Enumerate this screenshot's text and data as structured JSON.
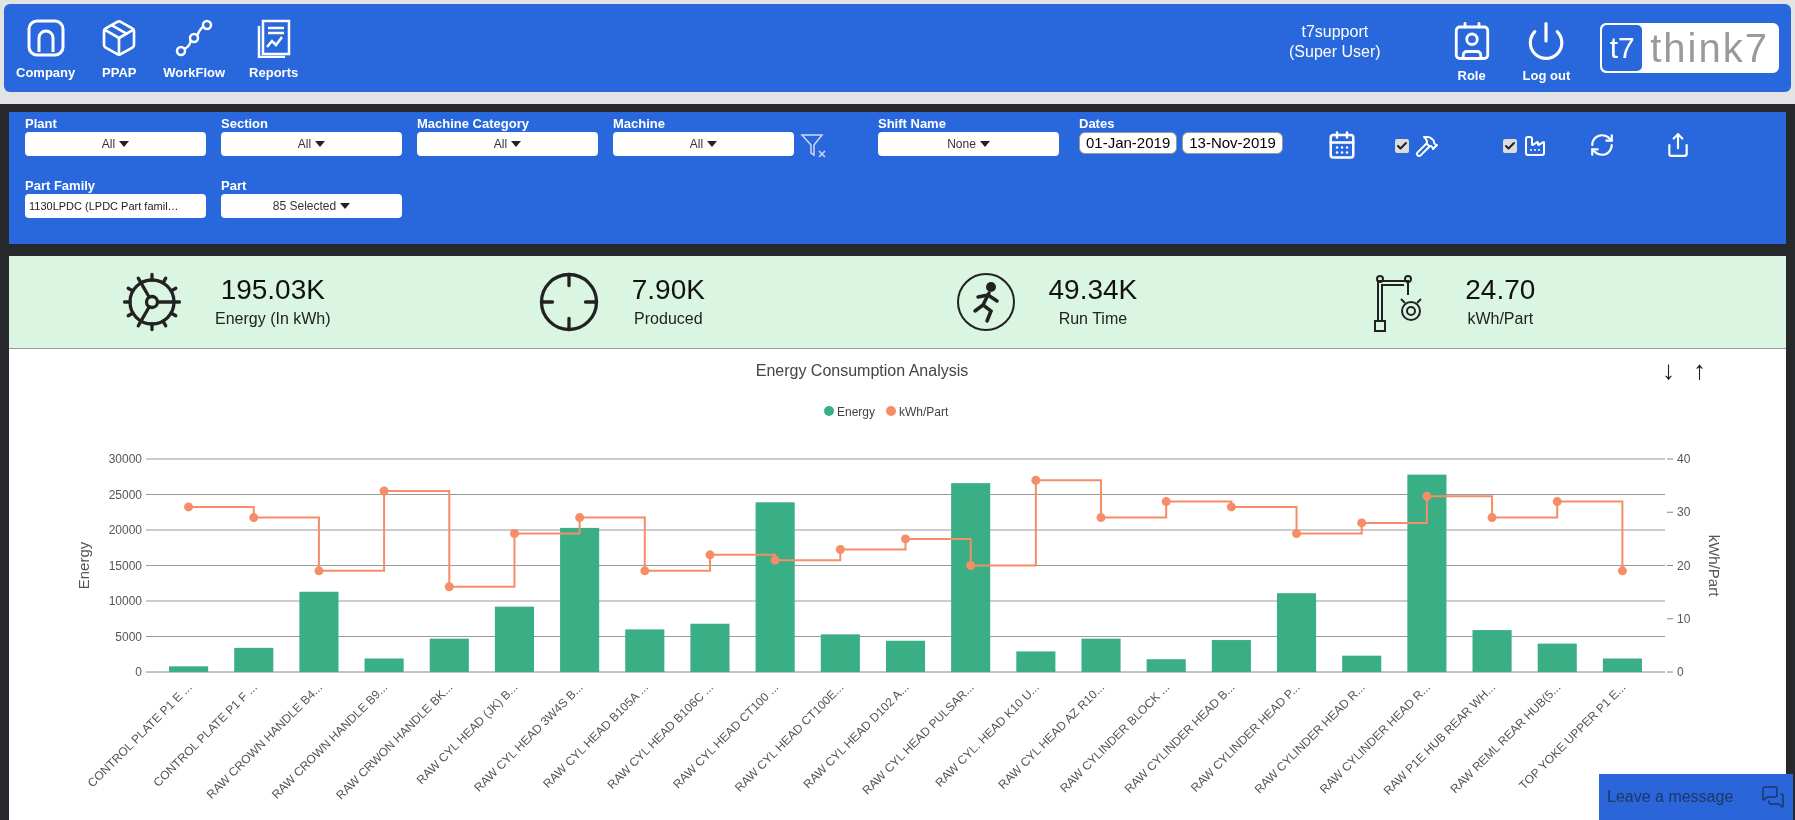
{
  "header": {
    "nav": [
      {
        "label": "Company",
        "kind": "company"
      },
      {
        "label": "PPAP",
        "kind": "box"
      },
      {
        "label": "WorkFlow",
        "kind": "workflow"
      },
      {
        "label": "Reports",
        "kind": "reports"
      }
    ],
    "user": {
      "name": "t7support",
      "role": "(Super User)"
    },
    "actions": [
      {
        "label": "Role",
        "kind": "role"
      },
      {
        "label": "Log out",
        "kind": "logout"
      }
    ],
    "logo": {
      "mark": "t7",
      "text": "think7"
    }
  },
  "filters": {
    "row1": [
      {
        "label": "Plant",
        "value": "All",
        "kind": "dropdown"
      },
      {
        "label": "Section",
        "value": "All",
        "kind": "dropdown"
      },
      {
        "label": "Machine Category",
        "value": "All",
        "kind": "dropdown"
      },
      {
        "label": "Machine",
        "value": "All",
        "kind": "dropdown"
      }
    ],
    "shift": {
      "label": "Shift Name",
      "value": "None",
      "kind": "dropdown"
    },
    "dates": {
      "label": "Dates",
      "from": "01-Jan-2019",
      "to": "13-Nov-2019"
    },
    "toggles": [
      {
        "kind": "tool",
        "checked": true
      },
      {
        "kind": "machine",
        "checked": true
      }
    ],
    "row2": [
      {
        "label": "Part Family",
        "value": "1130LPDC (LPDC Part famil…",
        "kind": "text"
      },
      {
        "label": "Part",
        "value": "85 Selected",
        "kind": "dropdown"
      }
    ]
  },
  "kpis": [
    {
      "value": "195.03K",
      "label": "Energy (In kWh)",
      "kind": "energy"
    },
    {
      "value": "7.90K",
      "label": "Produced",
      "kind": "target"
    },
    {
      "value": "49.34K",
      "label": "Run Time",
      "kind": "run"
    },
    {
      "value": "24.70",
      "label": "kWh/Part",
      "kind": "robot"
    }
  ],
  "chart": {
    "sort_buttons": [
      "↓",
      "↑"
    ],
    "chart_data": {
      "type": "bar",
      "title": "Energy Consumption Analysis",
      "ylabel": "Energy",
      "y2label": "kWh/Part",
      "categories": [
        "CONTROL PLATE P1 E ...",
        "CONTROL PLATE P1 F ...",
        "RAW CROWN HANDLE B4...",
        "RAW CROWN HANDLE B9...",
        "RAW CRWON HANDLE BK...",
        "RAW CYL HEAD (JK) B...",
        "RAW CYL HEAD 3W4S B...",
        "RAW CYL HEAD B105A ...",
        "RAW CYL HEAD B106C ...",
        "RAW CYL HEAD CT100 ...",
        "RAW CYL HEAD CT100E...",
        "RAW CYL HEAD D102 A...",
        "RAW CYL HEAD PULSAR...",
        "RAW CYL. HEAD K10 U...",
        "RAW CYL HEAD AZ R10...",
        "RAW CYLINDER BLOCK ...",
        "RAW CYLINDER HEAD B...",
        "RAW CYLINDER HEAD P...",
        "RAW CYLINDER HEAD R...",
        "RAW CYLINDER HEAD R...",
        "RAW P1E HUB REAR WH...",
        "RAW REML REAR HUB(5...",
        "TOP YOKE UPPER P1 E..."
      ],
      "series": [
        {
          "name": "Energy",
          "color": "#3aae84",
          "type": "bar",
          "values": [
            800,
            3400,
            11300,
            1900,
            4700,
            9200,
            20300,
            6000,
            6800,
            23900,
            5300,
            4400,
            26600,
            2900,
            4700,
            1800,
            4500,
            11100,
            2300,
            27800,
            5900,
            4000,
            1900
          ]
        },
        {
          "name": "kWh/Part",
          "color": "#f58d68",
          "type": "step",
          "marker": "circle",
          "axis": "y2",
          "values": [
            31,
            29,
            19,
            34,
            16,
            26,
            29,
            19,
            22,
            21,
            23,
            25,
            20,
            36,
            29,
            32,
            31,
            26,
            28,
            33,
            29,
            32,
            19
          ]
        }
      ],
      "grid": true,
      "legend": true,
      "ylim": [
        0,
        30000
      ],
      "yticks": [
        0,
        5000,
        10000,
        15000,
        20000,
        25000,
        30000
      ],
      "y2lim": [
        0,
        40
      ],
      "y2ticks": [
        0,
        10,
        20,
        30,
        40
      ]
    }
  },
  "chat": {
    "label": "Leave a message"
  }
}
